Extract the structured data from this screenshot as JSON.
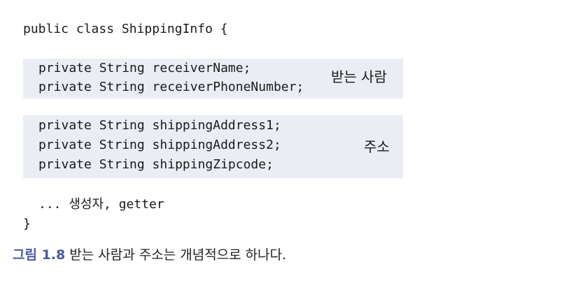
{
  "code": {
    "class_decl": "public class ShippingInfo {",
    "receiver_block": {
      "lines": [
        "private String receiverName;",
        "private String receiverPhoneNumber;"
      ],
      "label": "받는 사람"
    },
    "address_block": {
      "lines": [
        "private String shippingAddress1;",
        "private String shippingAddress2;",
        "private String shippingZipcode;"
      ],
      "label": "주소"
    },
    "ellipsis_line": "... 생성자, getter",
    "closing_brace": "}"
  },
  "caption": {
    "number": "그림 1.8",
    "text": " 받는 사람과 주소는 개념적으로 하나다."
  },
  "colors": {
    "block_background": "#eaedf3",
    "caption_number": "#4a5aa0"
  }
}
